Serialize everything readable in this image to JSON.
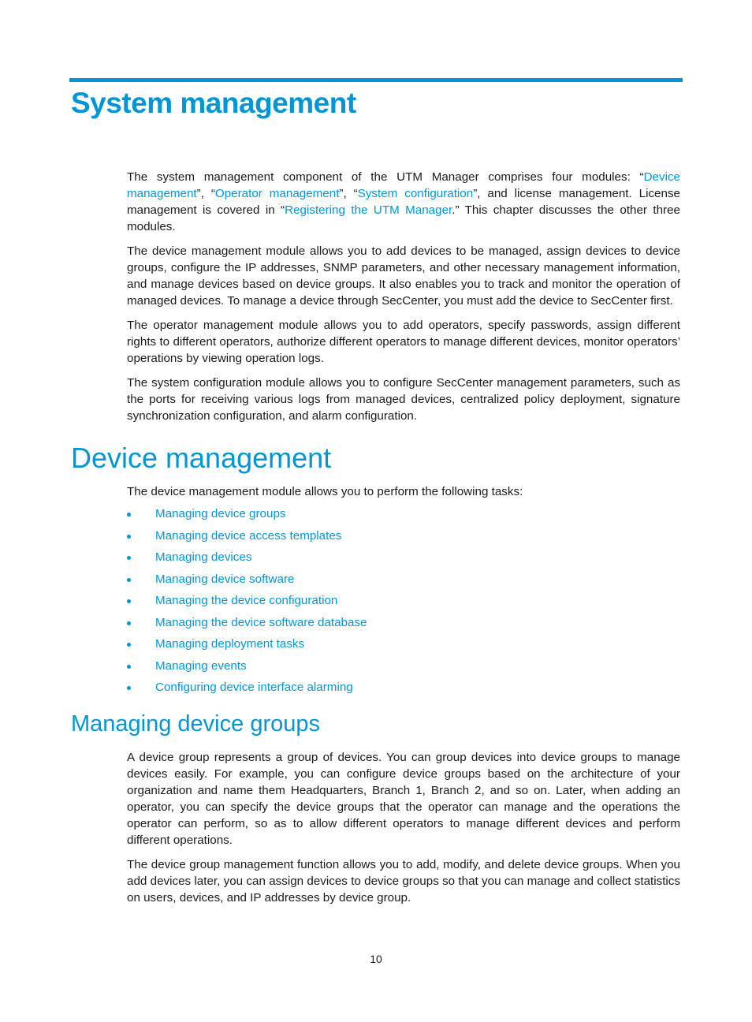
{
  "chapter": {
    "title": "System management",
    "intro": {
      "t1": "The system management component of the UTM Manager comprises four modules: “",
      "link1": "Device management",
      "t2": "”, “",
      "link2": "Operator management",
      "t3": "”, “",
      "link3": "System configuration",
      "t4": "”, and license management. License management is covered in “",
      "link4": "Registering the UTM Manager",
      "t5": ".” This chapter discusses the other three modules."
    },
    "paragraphs": [
      "The device management module allows you to add devices to be managed, assign devices to device groups, configure the IP addresses, SNMP parameters, and other necessary management information, and manage devices based on device groups. It also enables you to track and monitor the operation of managed devices. To manage a device through SecCenter, you must add the device to SecCenter first.",
      "The operator management module allows you to add operators, specify passwords, assign different rights to different operators, authorize different operators to manage different devices, monitor operators’ operations by viewing operation logs.",
      "The system configuration module allows you to configure SecCenter management parameters, such as the ports for receiving various logs from managed devices, centralized policy deployment, signature synchronization configuration, and alarm configuration."
    ]
  },
  "device_management": {
    "title": "Device management",
    "intro": "The device management module allows you to perform the following tasks:",
    "tasks": [
      "Managing device groups",
      "Managing device access templates",
      "Managing devices",
      "Managing device software",
      "Managing the device configuration",
      "Managing the device software database",
      "Managing deployment tasks",
      "Managing events",
      "Configuring device interface alarming"
    ]
  },
  "managing_device_groups": {
    "title": "Managing device groups",
    "paragraphs": [
      "A device group represents a group of devices. You can group devices into device groups to manage devices easily. For example, you can configure device groups based on the architecture of your organization and name them Headquarters, Branch 1, Branch 2, and so on. Later, when adding an operator, you can specify the device groups that the operator can manage and the operations the operator can perform, so as to allow different operators to manage different devices and perform different operations.",
      "The device group management function allows you to add, modify, and delete device groups. When you add devices later, you can assign devices to device groups so that you can manage and collect statistics on users, devices, and IP addresses by device group."
    ]
  },
  "footer": {
    "page_number": "10"
  },
  "colors": {
    "accent": "#0096d6",
    "text": "#1a1a1a"
  }
}
